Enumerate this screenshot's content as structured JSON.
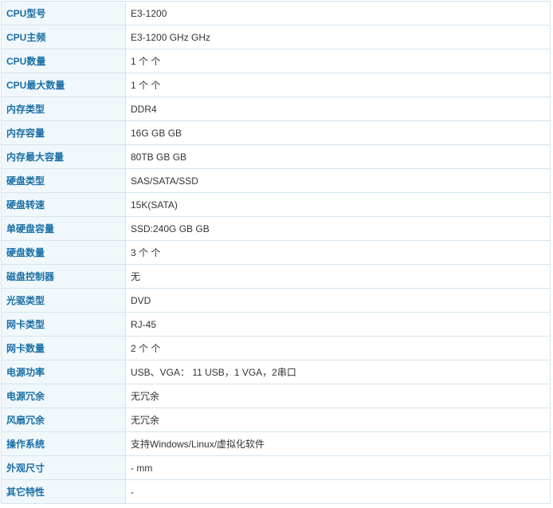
{
  "specs": [
    {
      "label": "CPU型号",
      "value": "E3-1200"
    },
    {
      "label": "CPU主频",
      "value": "E3-1200 GHz  GHz"
    },
    {
      "label": "CPU数量",
      "value": "1 个  个"
    },
    {
      "label": "CPU最大数量",
      "value": "1 个  个"
    },
    {
      "label": "内存类型",
      "value": "DDR4"
    },
    {
      "label": "内存容量",
      "value": "16G GB  GB"
    },
    {
      "label": "内存最大容量",
      "value": "80TB GB  GB"
    },
    {
      "label": "硬盘类型",
      "value": "SAS/SATA/SSD"
    },
    {
      "label": "硬盘转速",
      "value": "15K(SATA)"
    },
    {
      "label": "单硬盘容量",
      "value": "SSD:240G GB  GB"
    },
    {
      "label": "硬盘数量",
      "value": "3 个  个"
    },
    {
      "label": "磁盘控制器",
      "value": "无"
    },
    {
      "label": "光驱类型",
      "value": "DVD"
    },
    {
      "label": "网卡类型",
      "value": "RJ-45"
    },
    {
      "label": "网卡数量",
      "value": "2 个  个"
    },
    {
      "label": "电源功率",
      "value": "USB、VGA： 11 USB，1 VGA，2串口"
    },
    {
      "label": "电源冗余",
      "value": "无冗余"
    },
    {
      "label": "风扇冗余",
      "value": "无冗余"
    },
    {
      "label": "操作系统",
      "value": "支持Windows/Linux/虚拟化软件"
    },
    {
      "label": "外观尺寸",
      "value": "-  mm"
    },
    {
      "label": "其它特性",
      "value": "-"
    }
  ]
}
